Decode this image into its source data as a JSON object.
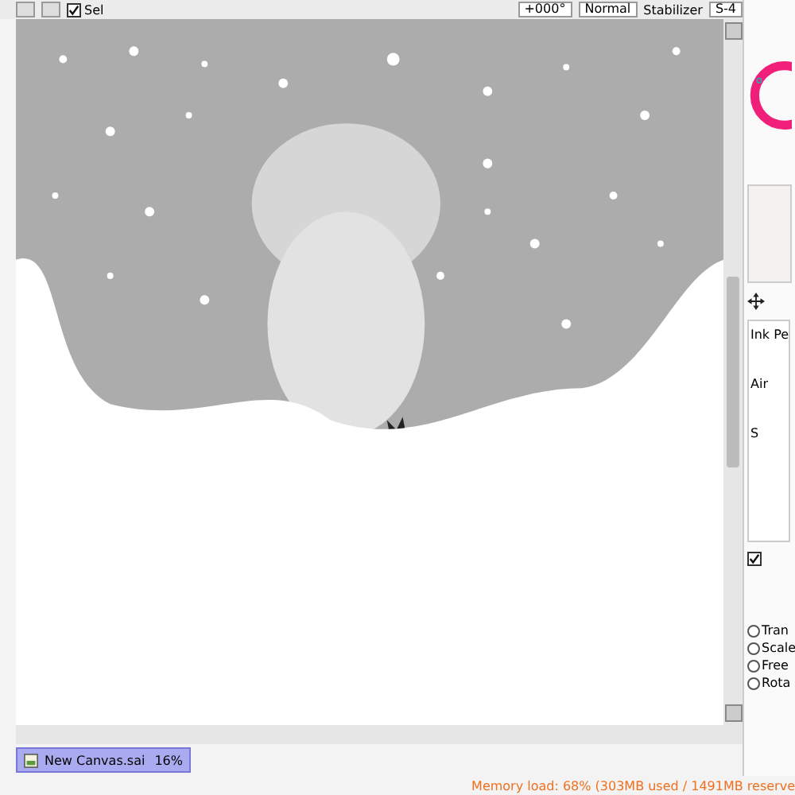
{
  "toolbar": {
    "selection_checkbox": {
      "label": "Sel",
      "checked": true
    },
    "rotation": "+000°",
    "blend_mode": "Normal",
    "stabilizer_label": "Stabilizer",
    "stabilizer": "S-4"
  },
  "brushes": [
    {
      "label": "Ink Pe"
    },
    {
      "label": "Air"
    },
    {
      "label": "S"
    }
  ],
  "option_checkbox": {
    "checked": true
  },
  "transform_options": [
    {
      "label": "Tran",
      "selected": false
    },
    {
      "label": "Scale",
      "selected": false
    },
    {
      "label": "Free",
      "selected": false
    },
    {
      "label": "Rota",
      "selected": false
    }
  ],
  "document_tabs": [
    {
      "name": "New Canvas.sai",
      "zoom": "16%",
      "selected": true
    }
  ],
  "status_bar": "Memory load: 68% (303MB used / 1491MB reserve"
}
